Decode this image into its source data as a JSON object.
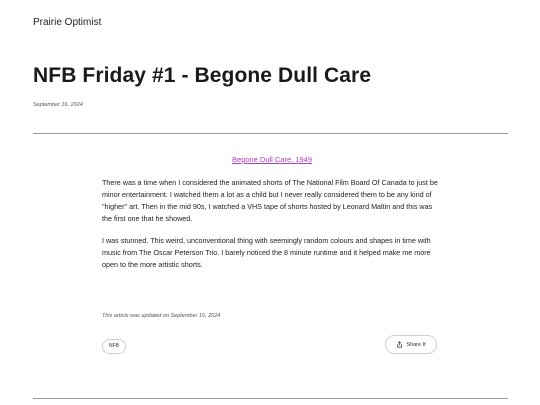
{
  "site": {
    "title": "Prairie Optimist"
  },
  "post": {
    "title": "NFB Friday #1 - Begone Dull Care",
    "date": "September 16, 2024",
    "video_link_text": "Begone Dull Care, 1949",
    "paragraphs": [
      "There was a time when I considered the animated shorts of The National Film Board Of Canada to just be minor entertainment. I watched them a lot as a child but I never really considered them to be any kind of \"higher\" art. Then in the mid 90s, I watched a VHS tape of shorts hosted by Leonard Maltin and this was the first one that he showed.",
      "I was stunned. This weird, unconventional thing with seemingly random colours and shapes in time with music from The Oscar Peterson Trio. I barely noticed the 8 minute runtime and it helped make me more open to the more artistic shorts."
    ],
    "updated_note": "This article was updated on September 16, 2024",
    "tags": [
      "NFB"
    ],
    "share_label": "Share It"
  },
  "colors": {
    "link": "#b03fbf",
    "divider": "#9a9a9a",
    "text": "#222222"
  },
  "icons": {
    "share": "share-icon"
  }
}
